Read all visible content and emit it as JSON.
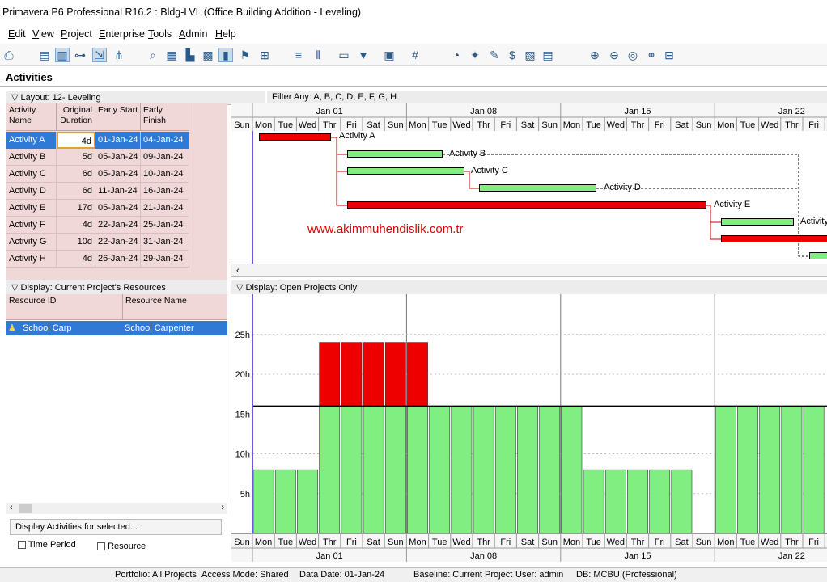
{
  "window": {
    "title": "Primavera P6 Professional R16.2 : Bldg-LVL (Office Building Addition - Leveling)"
  },
  "menu": [
    "Edit",
    "View",
    "Project",
    "Enterprise",
    "Tools",
    "Admin",
    "Help"
  ],
  "page": {
    "title": "Activities"
  },
  "layout": {
    "label": "Layout: 12- Leveling",
    "filter": "Filter Any: A, B, C, D, E, F, G, H"
  },
  "activity_table": {
    "headers": {
      "name": "Activity Name",
      "duration": "Original Duration",
      "early_start": "Early Start",
      "early_finish": "Early Finish"
    },
    "rows": [
      {
        "name": "Activity A",
        "duration": "4d",
        "start": "01-Jan-24",
        "finish": "04-Jan-24"
      },
      {
        "name": "Activity B",
        "duration": "5d",
        "start": "05-Jan-24",
        "finish": "09-Jan-24"
      },
      {
        "name": "Activity C",
        "duration": "6d",
        "start": "05-Jan-24",
        "finish": "10-Jan-24"
      },
      {
        "name": "Activity D",
        "duration": "6d",
        "start": "11-Jan-24",
        "finish": "16-Jan-24"
      },
      {
        "name": "Activity E",
        "duration": "17d",
        "start": "05-Jan-24",
        "finish": "21-Jan-24"
      },
      {
        "name": "Activity F",
        "duration": "4d",
        "start": "22-Jan-24",
        "finish": "25-Jan-24"
      },
      {
        "name": "Activity G",
        "duration": "10d",
        "start": "22-Jan-24",
        "finish": "31-Jan-24"
      },
      {
        "name": "Activity H",
        "duration": "4d",
        "start": "26-Jan-24",
        "finish": "29-Jan-24"
      }
    ]
  },
  "timescale": {
    "weeks": [
      "Jan 01",
      "Jan 08",
      "Jan 15",
      "Jan 22"
    ],
    "days": [
      "Sun",
      "Mon",
      "Tue",
      "Wed",
      "Thr",
      "Fri",
      "Sat",
      "Sun",
      "Mon",
      "Tue",
      "Wed",
      "Thr",
      "Fri",
      "Sat",
      "Sun",
      "Mon",
      "Tue",
      "Wed",
      "Thr",
      "Fri",
      "Sat",
      "Sun",
      "Mon",
      "Tue",
      "Wed",
      "Thr",
      "Fri"
    ]
  },
  "gantt_labels": [
    "Activity A",
    "Activity B",
    "Activity C",
    "Activity D",
    "Activity E",
    "Activity"
  ],
  "watermark": "www.akimmuhendislik.com.tr",
  "resources": {
    "display_label": "Display: Current Project's Resources",
    "headers": {
      "id": "Resource ID",
      "name": "Resource Name"
    },
    "row": {
      "id": "School Carp",
      "name": "School Carpenter"
    },
    "options_label": "Display Activities for selected...",
    "time_period": "Time Period",
    "resource": "Resource"
  },
  "histogram": {
    "display_label": "Display: Open Projects Only",
    "y_ticks": [
      "25h",
      "20h",
      "15h",
      "10h",
      "5h"
    ],
    "limit_hours": 16,
    "hours": [
      8,
      8,
      8,
      8,
      24,
      24,
      24,
      24,
      24,
      16,
      16,
      16,
      16,
      16,
      16,
      16,
      8,
      8,
      8,
      8,
      8,
      0,
      16,
      16,
      16,
      16,
      16
    ]
  },
  "colors": {
    "overalloc": "#ee0000",
    "normal": "#80ee80",
    "selected": "#2f7ad6"
  },
  "status": {
    "portfolio": "Portfolio: All Projects",
    "access": "Access Mode: Shared",
    "data_date": "Data Date: 01-Jan-24",
    "baseline": "Baseline: Current Project",
    "user": "User: admin",
    "db": "DB: MCBU (Professional)"
  }
}
